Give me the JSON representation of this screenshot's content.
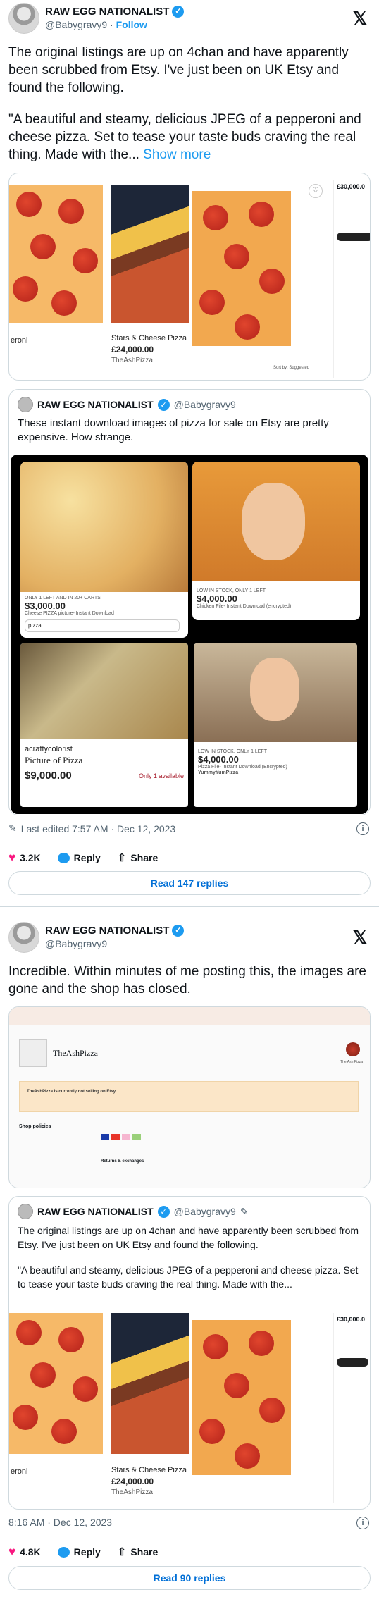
{
  "t1": {
    "name": "RAW EGG NATIONALIST",
    "handle": "@Babygravy9",
    "follow": "Follow",
    "p1": "The original listings are up on 4chan and have apparently been scrubbed from Etsy. I've just been on UK Etsy and found the following.",
    "p2": "\"A beautiful and steamy, delicious JPEG of a pepperoni and cheese pizza. Set to tease your taste buds craving the real thing. Made with the...",
    "more": "Show more",
    "listing": {
      "left_label": "eroni",
      "title": "Stars & Cheese Pizza",
      "price": "£24,000.00",
      "shop": "TheAshPizza",
      "side_price": "£30,000.0",
      "sorted": "Sort by: Suggested"
    },
    "quote": {
      "name": "RAW EGG NATIONALIST",
      "handle": "@Babygravy9",
      "text": "These instant download images of pizza for sale on Etsy are pretty expensive. How strange.",
      "a_stock": "ONLY 1 LEFT AND IN 20+ CARTS",
      "a_price": "$3,000.00",
      "a_title": "Cheese PIZZA picture- Instant Download",
      "a_search": "pizza",
      "b_stock": "LOW IN STOCK, ONLY 1 LEFT",
      "b_price": "$4,000.00",
      "b_title": "Chicken File- Instant Download (encrypted)",
      "c_shop": "acraftycolorist",
      "c_title": "Picture of Pizza",
      "c_price": "$9,000.00",
      "c_avail": "Only 1 available",
      "d_stock": "LOW IN STOCK, ONLY 1 LEFT",
      "d_price": "$4,000.00",
      "d_title": "Pizza File- Instant Download (Encrypted)",
      "d_shop": "YummyYumPizza"
    },
    "meta": "Last edited 7:57 AM · Dec 12, 2023",
    "likes": "3.2K",
    "reply": "Reply",
    "share": "Share",
    "read": "Read 147 replies"
  },
  "t2": {
    "name": "RAW EGG NATIONALIST",
    "handle": "@Babygravy9",
    "text": "Incredible. Within minutes of me posting this, the images are gone and the shop has closed.",
    "shop": {
      "name": "TheAshPizza",
      "owner": "The Ash Pizza",
      "notice": "TheAshPizza is currently not selling on Etsy",
      "policies": "Shop policies",
      "returns": "Returns & exchanges"
    },
    "quote": {
      "name": "RAW EGG NATIONALIST",
      "handle": "@Babygravy9",
      "p1": "The original listings are up on 4chan and have apparently been scrubbed from Etsy. I've just been on UK Etsy and found the following.",
      "p2": "\"A beautiful and steamy, delicious JPEG of a pepperoni and cheese pizza. Set to tease your taste buds craving the real thing. Made with the..."
    },
    "listing": {
      "left_label": "eroni",
      "title": "Stars & Cheese Pizza",
      "price": "£24,000.00",
      "shop": "TheAshPizza",
      "side_price": "£30,000.0"
    },
    "meta": "8:16 AM · Dec 12, 2023",
    "likes": "4.8K",
    "reply": "Reply",
    "share": "Share",
    "read": "Read 90 replies"
  },
  "colors": {
    "accent": "#1d9bf0",
    "like": "#f91880"
  }
}
